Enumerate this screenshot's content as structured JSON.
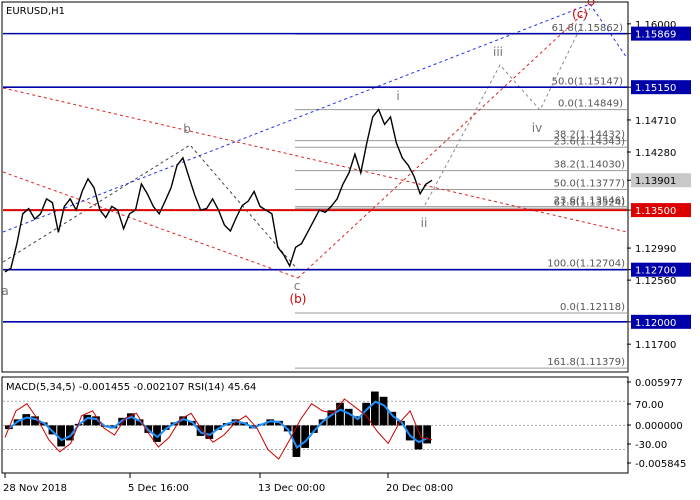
{
  "symbol_title": "EURUSD,H1",
  "indicator_title": "MACD(5,34,5) -0.001455 -0.002107 RSI(14) 45.64",
  "colors": {
    "background": "#ffffff",
    "price": "#000000",
    "h_line_blue": "#0000aa",
    "h_line_red": "#dd0000",
    "fib_line": "#9a9a9a",
    "trend_red": "#dd2222",
    "trend_blue": "#2233ee",
    "projection": "#8a8a8a",
    "macd_blue": "#1e90ff",
    "tag_blue": "#0000aa",
    "tag_red": "#dd0000",
    "tag_gray": "#c8c8c8",
    "wave_gray": "#777777",
    "wave_red": "#cc0000"
  },
  "chart_data": [
    {
      "type": "line",
      "title": "EURUSD,H1",
      "xlabel": "",
      "ylabel": "",
      "ylim": [
        1.1134,
        1.1628
      ],
      "x_tick_labels": [
        "28 Nov 2018",
        "5 Dec 16:00",
        "13 Dec 00:00",
        "20 Dec 08:00"
      ],
      "y_tick_labels": [
        "1.16000",
        "1.15869",
        "1.15150",
        "1.14710",
        "1.14280",
        "1.13901",
        "1.13500",
        "1.12990",
        "1.12700",
        "1.12560",
        "1.12000",
        "1.11700"
      ],
      "horizontal_levels": [
        {
          "value": 1.15869,
          "label": "1.15869",
          "color": "blue"
        },
        {
          "value": 1.1515,
          "label": "1.15150",
          "color": "blue"
        },
        {
          "value": 1.135,
          "label": "1.13500",
          "color": "red"
        },
        {
          "value": 1.127,
          "label": "1.12700",
          "color": "blue"
        },
        {
          "value": 1.12,
          "label": "1.12000",
          "color": "blue"
        }
      ],
      "current_price": {
        "value": 1.13901,
        "label": "1.13901"
      },
      "fibonacci_levels": [
        {
          "label": "61.8(1.15862)",
          "value": 1.15862
        },
        {
          "label": "50.0(1.15147)",
          "value": 1.15147
        },
        {
          "label": "0.0(1.14849)",
          "value": 1.14849
        },
        {
          "label": "38.2(1.14432)",
          "value": 1.14432
        },
        {
          "label": "23.6(1.14343)",
          "value": 1.14343
        },
        {
          "label": "38.2(1.14030)",
          "value": 1.1403
        },
        {
          "label": "50.0(1.13777)",
          "value": 1.13777
        },
        {
          "label": "61.8(1.13524)",
          "value": 1.13524
        },
        {
          "label": "23.6(1.13546)",
          "value": 1.13546
        },
        {
          "label": "100.0(1.12704)",
          "value": 1.12704
        },
        {
          "label": "0.0(1.12118)",
          "value": 1.12118
        },
        {
          "label": "161.8(1.11379)",
          "value": 1.11379
        }
      ],
      "wave_labels": [
        "i",
        "ii",
        "iii",
        "iv",
        "b",
        "c",
        "(b)",
        "(c)",
        "a"
      ],
      "series": [
        {
          "values": [
            1.1267,
            1.1272,
            1.1305,
            1.1345,
            1.1352,
            1.1338,
            1.1345,
            1.1365,
            1.136,
            1.132,
            1.1355,
            1.1365,
            1.135,
            1.1375,
            1.1392,
            1.138,
            1.135,
            1.134,
            1.1355,
            1.135,
            1.1325,
            1.1345,
            1.135,
            1.1385,
            1.1372,
            1.1355,
            1.1345,
            1.1362,
            1.138,
            1.141,
            1.142,
            1.1395,
            1.137,
            1.135,
            1.1352,
            1.1365,
            1.135,
            1.133,
            1.1322,
            1.134,
            1.1356,
            1.1362,
            1.1375,
            1.1355,
            1.135,
            1.1345,
            1.13,
            1.129,
            1.1275,
            1.13,
            1.1305,
            1.132,
            1.1335,
            1.135,
            1.1347,
            1.1355,
            1.1365,
            1.1385,
            1.14,
            1.1425,
            1.14,
            1.144,
            1.1475,
            1.1485,
            1.1465,
            1.1475,
            1.144,
            1.142,
            1.141,
            1.1395,
            1.1372,
            1.1385,
            1.139
          ]
        }
      ]
    },
    {
      "type": "bar",
      "title": "MACD(5,34,5) -0.001455 -0.002107 RSI(14) 45.64",
      "xlabel": "",
      "ylabel": "",
      "ylim": [
        -0.0062,
        0.0063
      ],
      "y_tick_labels": [
        "0.005977",
        "70.00",
        "0.000000",
        "-30.00",
        "-0.005845"
      ],
      "series": [
        {
          "name": "MACD",
          "values": [
            -0.0005,
            0.0008,
            0.0015,
            0.0012,
            0.0004,
            -0.0012,
            -0.0028,
            -0.002,
            0.0002,
            0.0014,
            0.0012,
            -0.0002,
            -0.0004,
            0.001,
            0.0016,
            0.0008,
            -0.001,
            -0.0022,
            -0.0006,
            0.0004,
            0.0012,
            0.0006,
            -0.0014,
            -0.0018,
            -0.0006,
            0.0003,
            0.0008,
            0.0004,
            -0.0004,
            0.0002,
            0.0008,
            0.0006,
            -0.0008,
            -0.0042,
            -0.003,
            -0.001,
            0.0008,
            0.002,
            0.003,
            0.0022,
            0.0012,
            0.003,
            0.0045,
            0.0038,
            0.0018,
            0.0006,
            -0.002,
            -0.0032,
            -0.0024
          ]
        },
        {
          "name": "RSI",
          "values": [
            40,
            62,
            68,
            55,
            38,
            28,
            35,
            58,
            62,
            48,
            42,
            56,
            60,
            45,
            32,
            40,
            55,
            60,
            46,
            36,
            42,
            52,
            58,
            48,
            30,
            22,
            38,
            55,
            68,
            62,
            60,
            72,
            65,
            58,
            45,
            35,
            52,
            62,
            40,
            38
          ]
        }
      ]
    }
  ]
}
